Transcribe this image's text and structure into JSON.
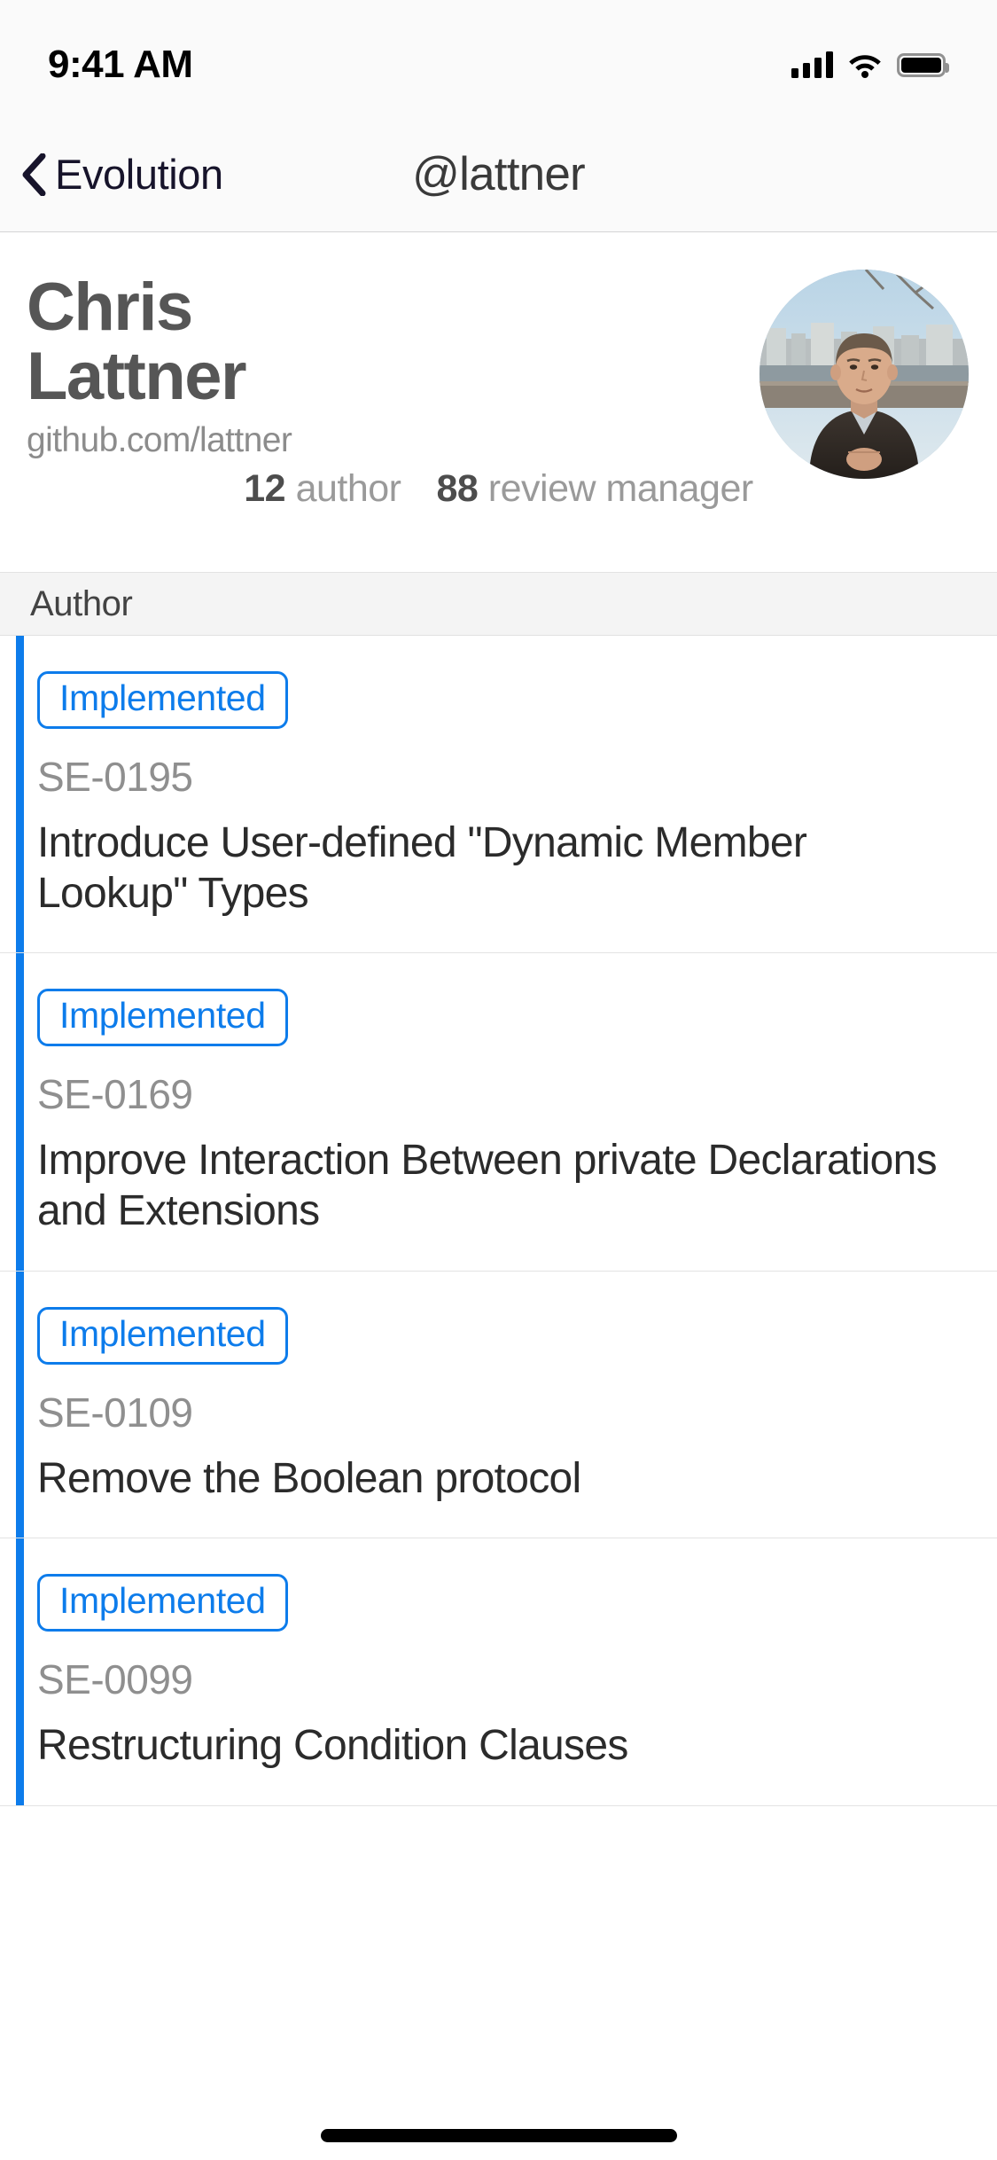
{
  "status_bar": {
    "time": "9:41 AM",
    "cellular_icon": "cellular-bars-icon",
    "wifi_icon": "wifi-icon",
    "battery_icon": "battery-full-icon"
  },
  "nav": {
    "back_icon": "chevron-left-icon",
    "back_label": "Evolution",
    "title": "@lattner"
  },
  "profile": {
    "name": "Chris Lattner",
    "url": "github.com/lattner",
    "avatar_icon": "user-avatar-photo",
    "stats": [
      {
        "count": "12",
        "label": "author"
      },
      {
        "count": "88",
        "label": "review manager"
      }
    ]
  },
  "section": {
    "header": "Author"
  },
  "proposals": [
    {
      "status": "Implemented",
      "id": "SE-0195",
      "title": "Introduce User-defined \"Dynamic Member Lookup\" Types"
    },
    {
      "status": "Implemented",
      "id": "SE-0169",
      "title": "Improve Interaction Between private Declarations and Extensions"
    },
    {
      "status": "Implemented",
      "id": "SE-0109",
      "title": "Remove the Boolean protocol"
    },
    {
      "status": "Implemented",
      "id": "SE-0099",
      "title": "Restructuring Condition Clauses"
    }
  ],
  "colors": {
    "accent_blue": "#0d7ceb",
    "nav_background": "#fafafa",
    "section_background": "#f4f4f4",
    "name_gray": "#565656",
    "muted_gray": "#8f8f8f"
  }
}
